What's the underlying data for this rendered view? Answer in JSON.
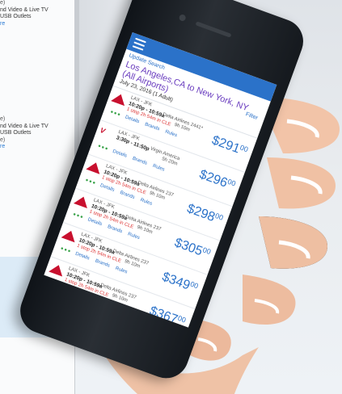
{
  "background": {
    "blocks": [
      {
        "lines": [
          "e)",
          "nd Video & Live TV",
          "USB Outlets",
          "e)"
        ],
        "more": "re"
      },
      {
        "lines": [
          "e)",
          "nd Video & Live TV",
          "USB Outlets",
          "e)"
        ],
        "more": "re"
      }
    ]
  },
  "app": {
    "update_search": "Update Search",
    "filter": "Filter",
    "route": "Los Angeles,CA to New York, NY (All Airports)",
    "date": "July 23, 2016 (1 Adult)"
  },
  "flights": [
    {
      "codes": "LAX - JFK",
      "times": "10:20p - 10:59a",
      "airline": "Delta Airlines 2441*",
      "stops": "1 stop 2h 54m in CLE",
      "duration": "9h 10m",
      "price": "$291",
      "cents": "00",
      "links": [
        "Details",
        "Brands",
        "Rules"
      ],
      "carrier": "delta"
    },
    {
      "codes": "LAX - JFK",
      "times": "3:30p - 11:50p",
      "airline": "Virgin America",
      "stops": "",
      "duration": "5h 20m",
      "price": "$296",
      "cents": "00",
      "links": [
        "Details",
        "Brands",
        "Rules"
      ],
      "carrier": "virgin"
    },
    {
      "codes": "LAX - JFK",
      "times": "10:20p - 10:59a",
      "airline": "Delta Airlines 237",
      "stops": "1 stop 2h 54m in CLE",
      "duration": "9h 10m",
      "price": "$298",
      "cents": "00",
      "links": [
        "Details",
        "Brands",
        "Rules"
      ],
      "carrier": "delta"
    },
    {
      "codes": "LAX - JFK",
      "times": "10:20p - 10:59a",
      "airline": "Delta Airlines 237",
      "stops": "1 stop 2h 54m in CLE",
      "duration": "9h 10m",
      "price": "$305",
      "cents": "00",
      "links": [
        "Details",
        "Brands",
        "Rules"
      ],
      "carrier": "delta"
    },
    {
      "codes": "LAX - JFK",
      "times": "10:20p - 10:59a",
      "airline": "Delta Airlines 237",
      "stops": "1 stop 2h 54m in CLE",
      "duration": "9h 10m",
      "price": "$349",
      "cents": "00",
      "links": [
        "Details",
        "Brands",
        "Rules"
      ],
      "carrier": "delta"
    },
    {
      "codes": "LAX - JFK",
      "times": "10:20p - 10:59a",
      "airline": "Delta Airlines 237",
      "stops": "1 stop 2h 54m in CLE",
      "duration": "9h 10m",
      "price": "$367",
      "cents": "00",
      "links": [
        "Details",
        "Brands",
        "Rules"
      ],
      "carrier": "delta"
    }
  ]
}
